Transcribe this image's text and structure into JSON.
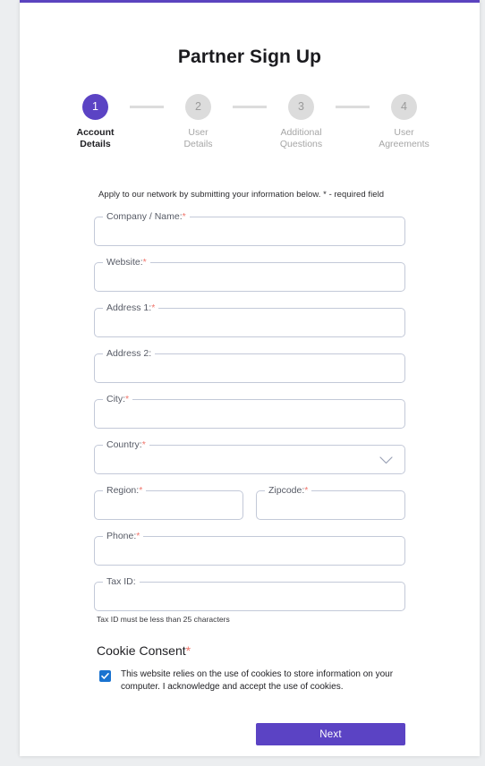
{
  "theme": {
    "accent_purple": "#5b43c4",
    "top_bar_purple": "#5b43bf",
    "required_star_red": "#f0756b",
    "checkbox_blue": "#1a73d0",
    "field_border": "#c3c9d8",
    "inactive_grey": "#dcdcdc"
  },
  "header": {
    "title": "Partner Sign Up"
  },
  "stepper": {
    "steps": [
      {
        "number": "1",
        "label": "Account\nDetails",
        "active": true
      },
      {
        "number": "2",
        "label": "User\nDetails",
        "active": false
      },
      {
        "number": "3",
        "label": "Additional\nQuestions",
        "active": false
      },
      {
        "number": "4",
        "label": "User\nAgreements",
        "active": false
      }
    ]
  },
  "form": {
    "intro": "Apply to our network by submitting your information below. * - required field",
    "required_marker": "*",
    "fields": {
      "company_name": {
        "label": "Company / Name:",
        "required": true,
        "value": "",
        "placeholder": ""
      },
      "website": {
        "label": "Website:",
        "required": true,
        "value": "",
        "placeholder": ""
      },
      "address1": {
        "label": "Address 1:",
        "required": true,
        "value": "",
        "placeholder": ""
      },
      "address2": {
        "label": "Address 2:",
        "required": false,
        "value": "",
        "placeholder": ""
      },
      "city": {
        "label": "City:",
        "required": true,
        "value": "",
        "placeholder": ""
      },
      "country": {
        "label": "Country:",
        "required": true,
        "value": "",
        "selected_option": "",
        "options": [
          ""
        ]
      },
      "region": {
        "label": "Region:",
        "required": true,
        "value": "",
        "placeholder": ""
      },
      "zipcode": {
        "label": "Zipcode:",
        "required": true,
        "value": "",
        "placeholder": ""
      },
      "phone": {
        "label": "Phone:",
        "required": true,
        "value": "",
        "placeholder": ""
      },
      "tax_id": {
        "label": "Tax ID:",
        "required": false,
        "value": "",
        "placeholder": "",
        "helper": "Tax ID must be less than 25 characters"
      }
    }
  },
  "consent": {
    "heading": "Cookie Consent",
    "required_marker": "*",
    "checked": true,
    "text": "This website relies on the use of cookies to store information on your computer. I acknowledge and accept the use of cookies."
  },
  "actions": {
    "next_label": "Next"
  }
}
